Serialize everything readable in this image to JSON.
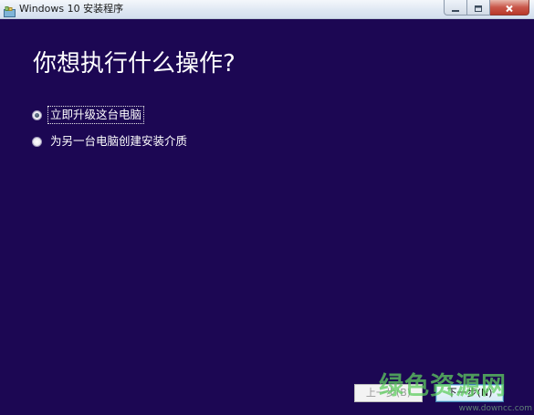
{
  "window": {
    "title": "Windows 10 安装程序",
    "icons": {
      "app": "setup-app-icon",
      "minimize": "minimize-icon",
      "maximize": "maximize-icon",
      "close": "close-icon"
    }
  },
  "main": {
    "heading": "你想执行什么操作?",
    "options": [
      {
        "label": "立即升级这台电脑",
        "selected": true
      },
      {
        "label": "为另一台电脑创建安装介质",
        "selected": false
      }
    ]
  },
  "buttons": {
    "back_label": "上一步(B)",
    "back_enabled": false,
    "next_label": "下一步(N)"
  },
  "watermark": {
    "text": "绿色资源网",
    "subtext": "www.downcc.com"
  },
  "colors": {
    "background": "#1c0753",
    "text": "#ffffff",
    "watermark": "#5fcd5f"
  }
}
